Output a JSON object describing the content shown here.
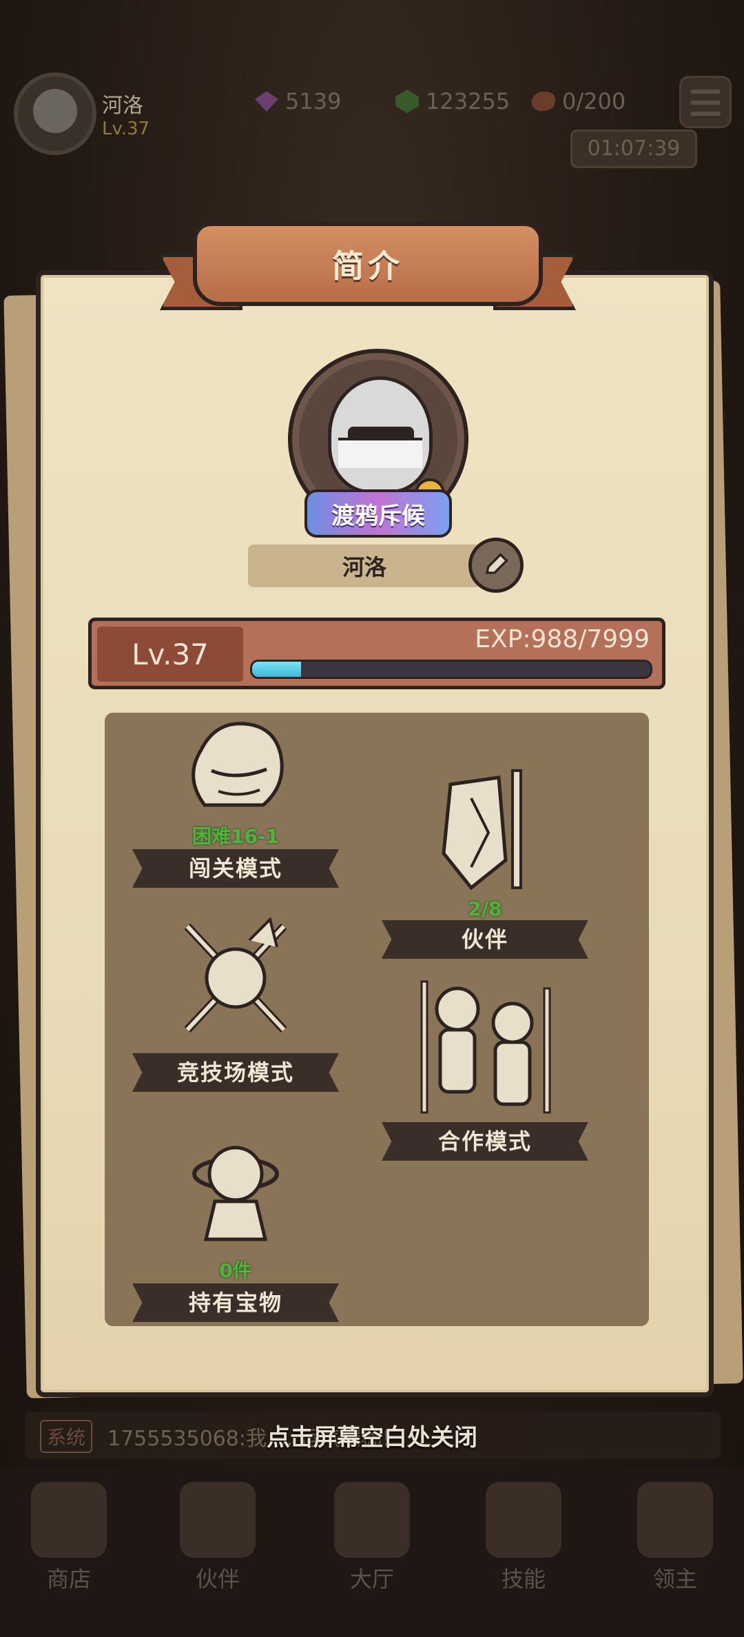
{
  "hud": {
    "player_name": "河洛",
    "player_level": "Lv.37",
    "purple_gems": "5139",
    "green_gems": "123255",
    "stamina": "0/200",
    "timer": "01:07:39"
  },
  "panel": {
    "title": "简介",
    "title_badge": "渡鸦斥候",
    "name": "河洛",
    "level": "Lv.37",
    "exp_text": "EXP:988/7999",
    "exp_fraction": 0.1235
  },
  "modes": [
    {
      "label": "闯关模式",
      "progress": "困难16-1"
    },
    {
      "label": "伙伴",
      "progress": "2/8"
    },
    {
      "label": "竞技场模式",
      "progress": ""
    },
    {
      "label": "合作模式",
      "progress": ""
    },
    {
      "label": "持有宝物",
      "progress": "0件"
    }
  ],
  "chat": {
    "tag": "系统",
    "message": "1755535068:我 ... 运气爆棚!"
  },
  "hint": "点击屏幕空白处关闭",
  "tabs": [
    {
      "label": "商店",
      "icon": "shop-icon"
    },
    {
      "label": "伙伴",
      "icon": "partner-icon"
    },
    {
      "label": "大厅",
      "icon": "lobby-icon"
    },
    {
      "label": "技能",
      "icon": "skill-icon"
    },
    {
      "label": "领主",
      "icon": "lord-icon"
    }
  ],
  "colors": {
    "panel": "#efe3c2",
    "banner": "#c47c53",
    "level_bar": "#b5705a",
    "exp_fill": "#3bb9d8",
    "mode_area": "#8a7457",
    "progress_text": "#4fb43c"
  }
}
